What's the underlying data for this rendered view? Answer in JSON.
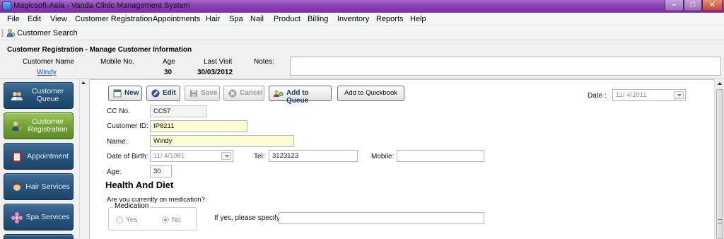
{
  "window": {
    "title": "Magicsoft-Asia - Vanda Clinic Management System"
  },
  "menu": [
    "File",
    "Edit",
    "View",
    "Customer Registration",
    "Appointments",
    "Hair",
    "Spa",
    "Nail",
    "Product",
    "Billing",
    "Inventory",
    "Reports",
    "Help"
  ],
  "toolbar": {
    "customer_search": "Customer Search"
  },
  "header": {
    "title": "Customer Registration - Manage Customer Information",
    "customer_name_label": "Customer Name",
    "customer_name": "Windy",
    "mobile_label": "Mobile No.",
    "mobile_value": "",
    "age_label": "Age",
    "age_value": "30",
    "last_visit_label": "Last Visit",
    "last_visit_value": "30/03/2012",
    "notes_label": "Notes:",
    "notes_value": ""
  },
  "sidebar": {
    "items": [
      {
        "label": "Customer Queue",
        "icon": "users-icon",
        "active": false
      },
      {
        "label": "Customer Registration",
        "icon": "user-edit-icon",
        "active": true
      },
      {
        "label": "Appointment",
        "icon": "appointment-book-icon",
        "active": false
      },
      {
        "label": "Hair Services",
        "icon": "hair-icon",
        "active": false
      },
      {
        "label": "Spa Services",
        "icon": "flower-icon",
        "active": false
      }
    ]
  },
  "actions": {
    "new": "New",
    "edit": "Edit",
    "save": "Save",
    "cancel": "Cancel",
    "add_to_queue": "Add to Queue",
    "add_to_quickbook": "Add to Quickbook"
  },
  "date": {
    "label": "Date",
    "colon": ":",
    "value": "11/ 4/2011"
  },
  "form": {
    "cc_no_label": "CC No.",
    "cc_no": "CC57",
    "customer_id_label": "Customer ID:",
    "customer_id": "IP8211",
    "name_label": "Name:",
    "name": "Windy",
    "dob_label": "Date of Birth:",
    "dob": "11/ 4/1981",
    "tel_label": "Tel:",
    "tel": "3123123",
    "mobile_label": "Mobile:",
    "mobile": "",
    "age_label": "Age:",
    "age": "30"
  },
  "health": {
    "title": "Health And Diet",
    "question": "Are you currently on medication?",
    "group_label": "Medication",
    "yes_label": "Yes",
    "no_label": "No",
    "selected": "No",
    "specify_label": "If yes, please specify",
    "specify_value": ""
  },
  "colors": {
    "nav_blue": "#27557d",
    "nav_active_green": "#73a236",
    "title_purple": "#8c3fb6",
    "input_yellow": "#fffcd3",
    "link_blue": "#1c4fc4"
  }
}
